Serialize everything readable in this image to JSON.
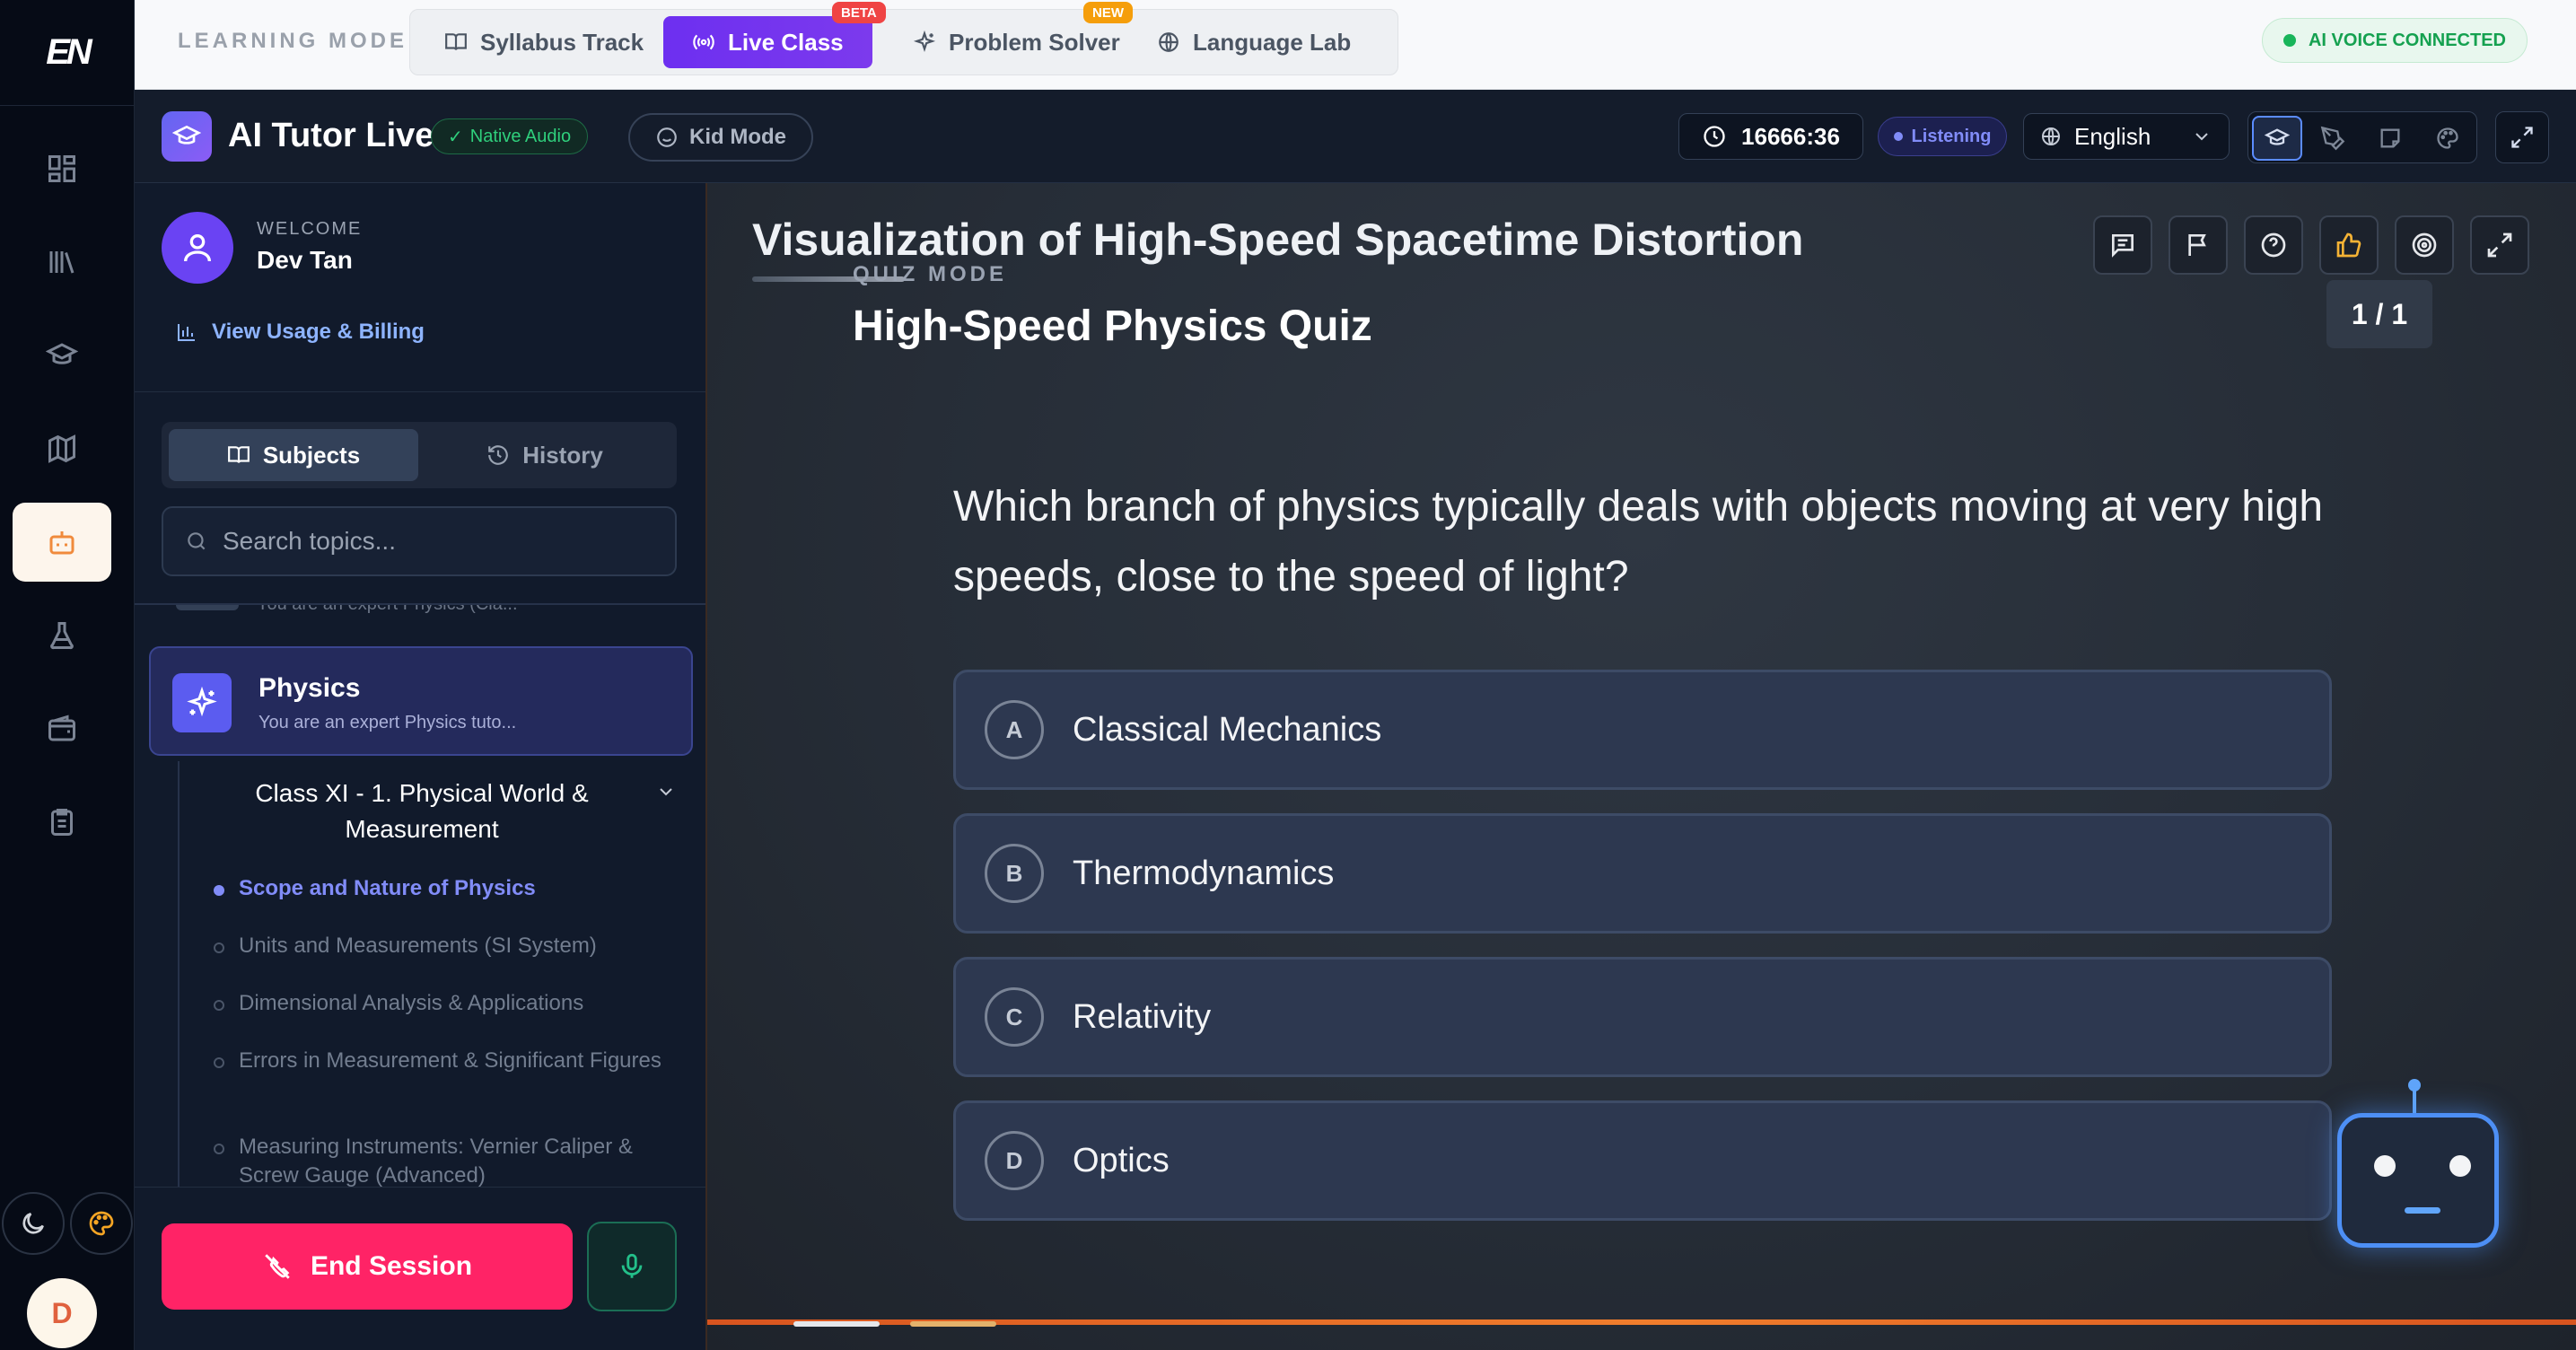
{
  "rail": {
    "logo": "EN",
    "avatar_initial": "D"
  },
  "topbar": {
    "label": "LEARNING MODE:",
    "modes": [
      {
        "label": "Syllabus Track",
        "icon": "book-open-icon"
      },
      {
        "label": "Live Class",
        "icon": "broadcast-icon",
        "badge": "BETA"
      },
      {
        "label": "Problem Solver",
        "icon": "sparkles-icon",
        "badge": "NEW"
      },
      {
        "label": "Language Lab",
        "icon": "globe-icon"
      }
    ],
    "status": "AI VOICE CONNECTED"
  },
  "header": {
    "title": "AI Tutor Live",
    "native_audio": "Native Audio",
    "kid_mode": "Kid Mode",
    "timer": "16666:36",
    "listening": "Listening",
    "language": "English"
  },
  "sidebar": {
    "welcome": "WELCOME",
    "username": "Dev Tan",
    "usage_link": "View Usage & Billing",
    "tabs": [
      "Subjects",
      "History"
    ],
    "search_placeholder": "Search topics...",
    "clipped_item": "You are an expert Physics (Cla...",
    "subject": {
      "name": "Physics",
      "desc": "You are an expert Physics tuto..."
    },
    "chapter": "Class XI - 1. Physical World & Measurement",
    "topics": [
      "Scope and Nature of Physics",
      "Units and Measurements (SI System)",
      "Dimensional Analysis & Applications",
      "Errors in Measurement & Significant Figures",
      "Measuring Instruments: Vernier Caliper & Screw Gauge (Advanced)"
    ],
    "end_session": "End Session"
  },
  "stage": {
    "title": "Visualization of High-Speed Spacetime Distortion",
    "mode_label": "QUIZ MODE",
    "quiz_title": "High-Speed Physics Quiz",
    "counter": "1 / 1",
    "question": "Which branch of physics typically deals with objects moving at very high speeds, close to the speed of light?",
    "options": [
      {
        "letter": "A",
        "text": "Classical Mechanics"
      },
      {
        "letter": "B",
        "text": "Thermodynamics"
      },
      {
        "letter": "C",
        "text": "Relativity"
      },
      {
        "letter": "D",
        "text": "Optics"
      }
    ]
  },
  "colors": {
    "accent": "#7c3aed",
    "end_session": "#ff2366",
    "listening": "#818cf8",
    "connected": "#15a150"
  }
}
